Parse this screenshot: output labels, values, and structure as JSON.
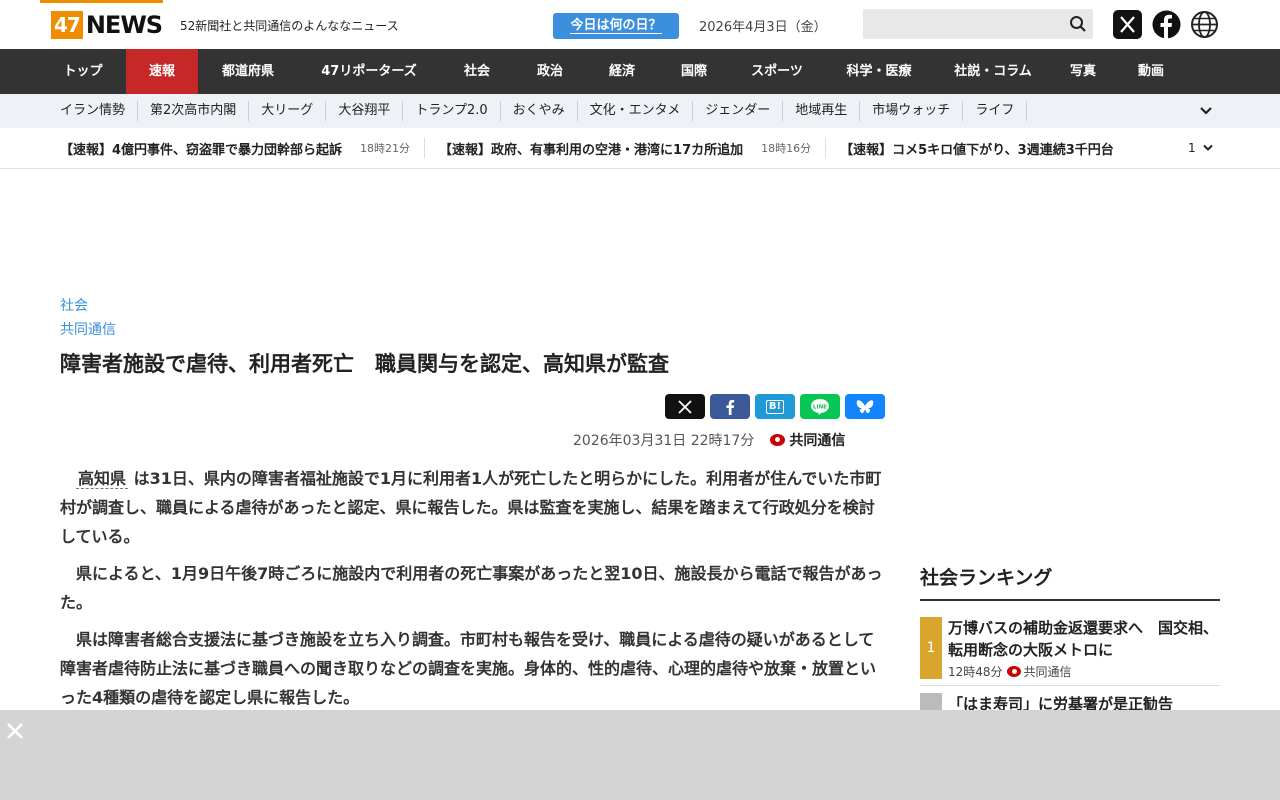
{
  "header": {
    "logo_num": "47",
    "logo_word": "NEWS",
    "tagline": "52新聞社と共同通信のよんななニュース",
    "today_button": "今日は何の日？",
    "date": "2026年4月3日（金）",
    "search_placeholder": ""
  },
  "main_nav": [
    "トップ",
    "速報",
    "都道府県",
    "47リポーターズ",
    "社会",
    "政治",
    "経済",
    "国際",
    "スポーツ",
    "科学・医療",
    "社説・コラム",
    "写真",
    "動画"
  ],
  "main_nav_active": "速報",
  "sub_nav": [
    "イラン情勢",
    "第2次高市内閣",
    "大リーグ",
    "大谷翔平",
    "トランプ2.0",
    "おくやみ",
    "文化・エンタメ",
    "ジェンダー",
    "地域再生",
    "市場ウォッチ",
    "ライフ"
  ],
  "ticker": {
    "items": [
      {
        "title": "【速報】4億円事件、窃盗罪で暴力団幹部ら起訴",
        "time": "18時21分"
      },
      {
        "title": "【速報】政府、有事利用の空港・港湾に17カ所追加",
        "time": "18時16分"
      },
      {
        "title": "【速報】コメ5キロ値下がり、3週連続3千円台",
        "time": ""
      }
    ],
    "count": "1"
  },
  "article": {
    "category": "社会",
    "source_link": "共同通信",
    "headline": "障害者施設で虐待、利用者死亡　職員関与を認定、高知県が監査",
    "datetime": "2026年03月31日 22時17分",
    "source": "共同通信",
    "keyword": "高知県",
    "p1_rest": " は31日、県内の障害者福祉施設で1月に利用者1人が死亡したと明らかにした。利用者が住んでいた市町村が調査し、職員による虐待があったと認定、県に報告した。県は監査を実施し、結果を踏まえて行政処分を検討している。",
    "p2": "県によると、1月9日午後7時ごろに施設内で利用者の死亡事案があったと翌10日、施設長から電話で報告があった。",
    "p3": "県は障害者総合支援法に基づき施設を立ち入り調査。市町村も報告を受け、職員による虐待の疑いがあるとして障害者虐待防止法に基づき職員への聞き取りなどの調査を実施。身体的、性的虐待、心理的虐待や放棄・放置といった4種類の虐待を認定し県に報告した。"
  },
  "share": {
    "x": "X",
    "facebook": "f",
    "hatena": "B!",
    "line": "LINE",
    "bluesky": "bsky"
  },
  "ranking": {
    "title": "社会ランキング",
    "items": [
      {
        "rank": "1",
        "title": "万博バスの補助金返還要求へ　国交相、転用断念の大阪メトロに",
        "time": "12時48分",
        "source": "共同通信"
      },
      {
        "rank": "",
        "title": "「はま寿司」に労基署が是正勧告",
        "time": "",
        "source": ""
      }
    ]
  },
  "colors": {
    "accent": "#f08c00",
    "nav_active": "#c62828",
    "link": "#3b8fdc",
    "rank_gold": "#d9a52c"
  }
}
